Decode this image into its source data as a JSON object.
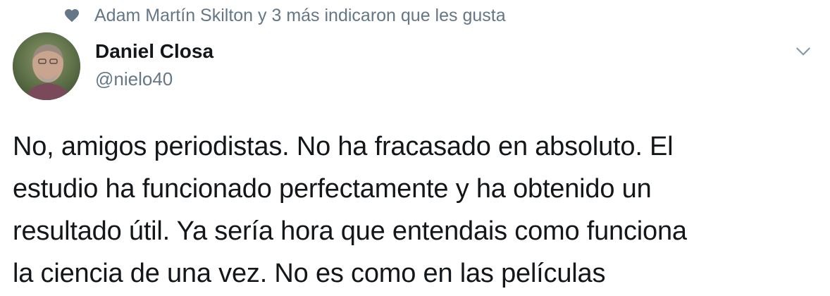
{
  "social_context": {
    "icon": "heart-icon",
    "text": "Adam Martín Skilton y 3 más indicaron que les gusta"
  },
  "author": {
    "avatar": "avatar",
    "display_name": "Daniel Closa",
    "handle": "@nielo40"
  },
  "menu": {
    "icon": "chevron-down-icon"
  },
  "tweet": {
    "text": "No, amigos periodistas. No ha fracasado en absoluto. El\nestudio ha funcionado perfectamente y ha obtenido un\nresultado útil. Ya sería hora que entendais como funciona\nla ciencia de una vez. No es como en las películas"
  },
  "colors": {
    "text_primary": "#14171a",
    "text_secondary": "#657786"
  }
}
